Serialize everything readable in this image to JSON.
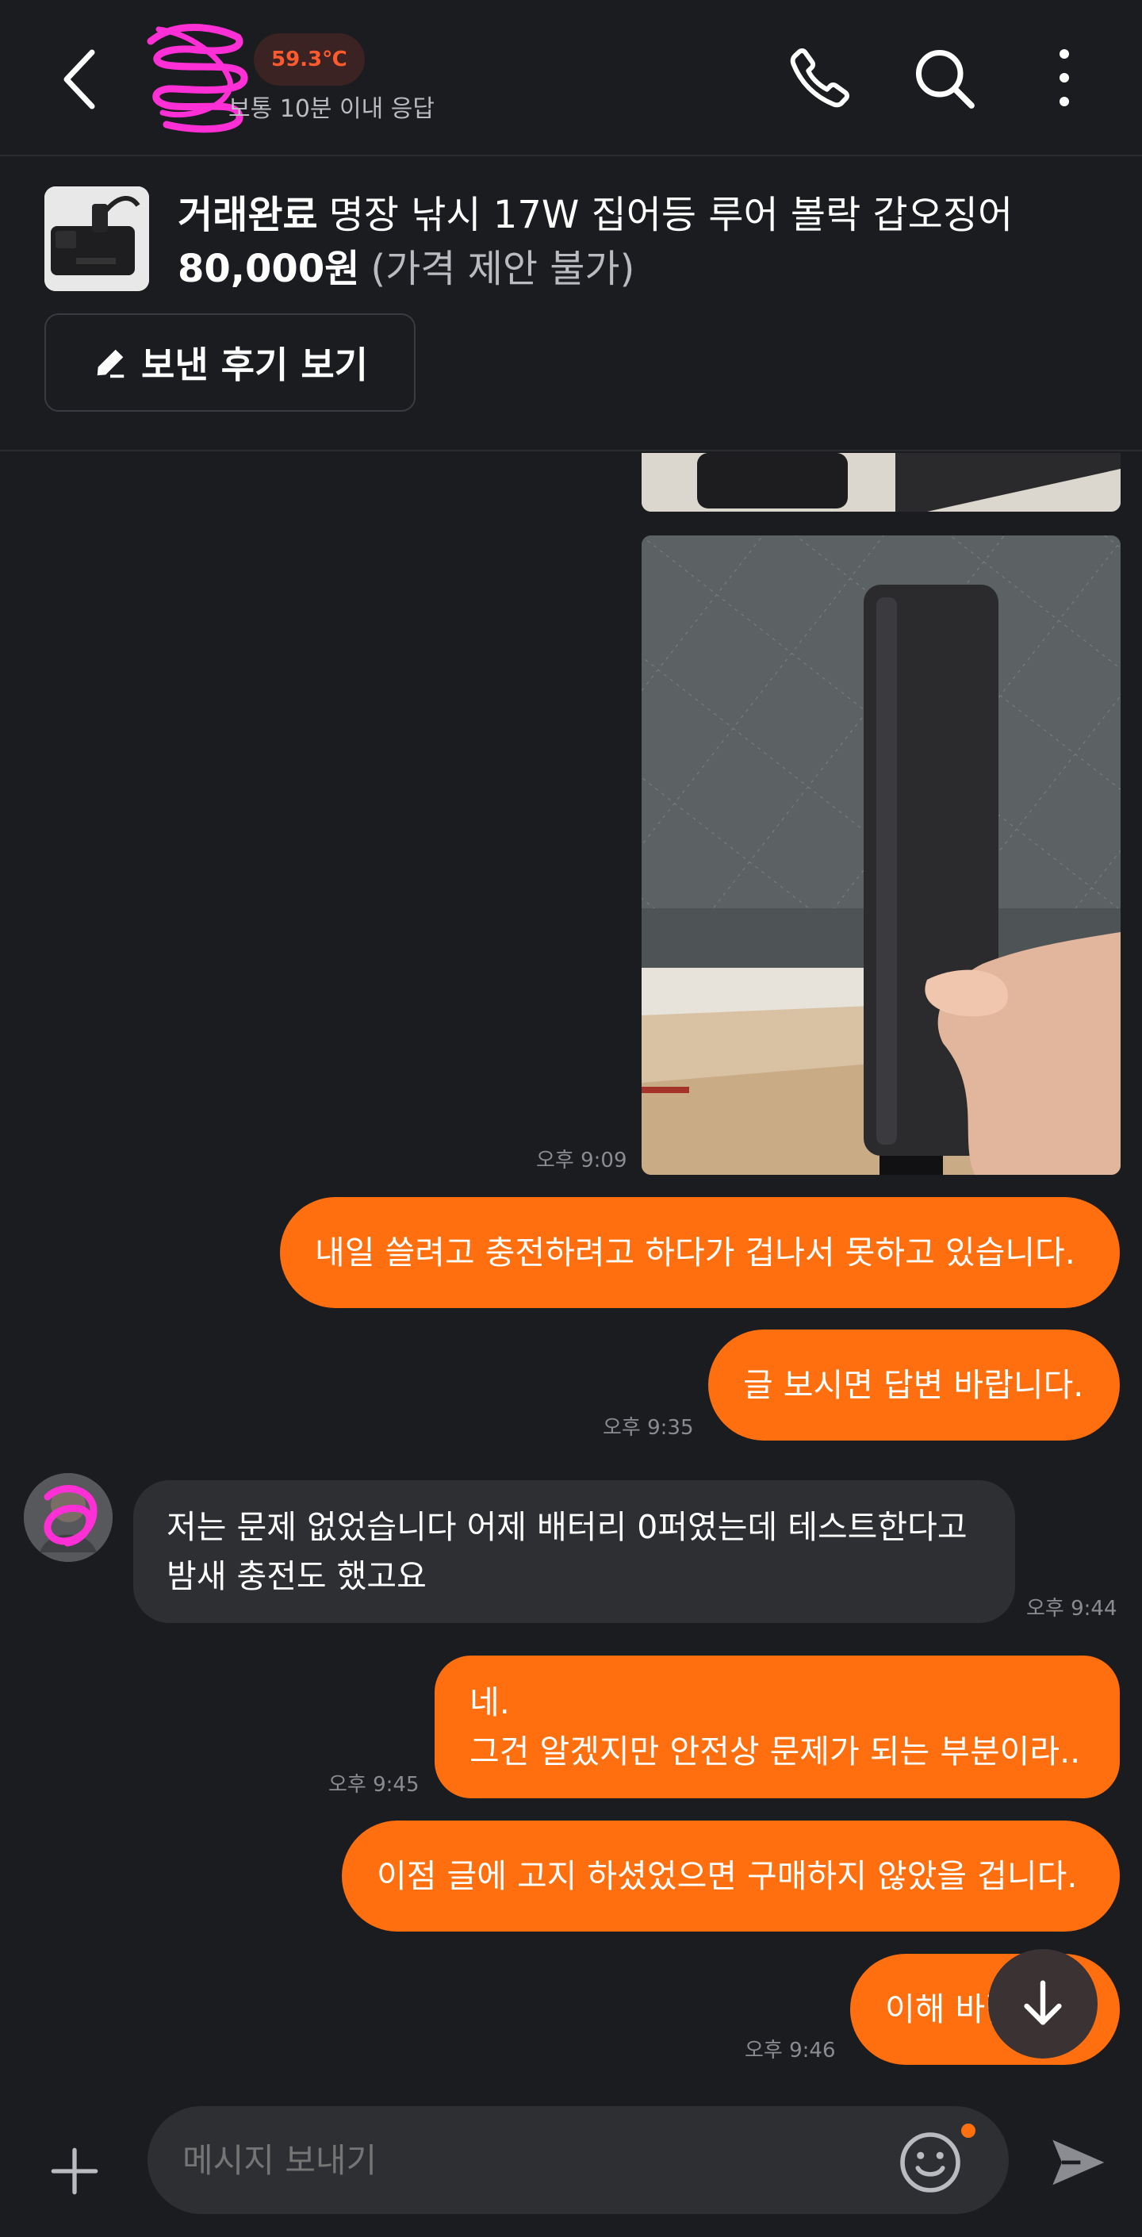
{
  "header": {
    "temperature": "59.3℃",
    "response_time": "보통 10분 이내 응답",
    "colors": {
      "accent": "#ff6f0f",
      "temp": "#ff5a2d",
      "background": "#1b1c1f"
    }
  },
  "product": {
    "status": "거래완료",
    "title": "명장 낚시 17W 집어등 루어 볼락 갑오징어",
    "price": "80,000원",
    "negotiation": "(가격 제안 불가)",
    "review_button": "보낸 후기 보기"
  },
  "messages": {
    "photo_time": "오후 9:09",
    "m1_text": "내일 쓸려고 충전하려고 하다가 겁나서 못하고 있습니다.",
    "m2_text": "글 보시면 답변 바랍니다.",
    "m2_time": "오후 9:35",
    "m3_line1": "저는 문제 없었습니다 어제 배터리 0퍼였는데 테스트한다고",
    "m3_line2": "밤새 충전도 했고요",
    "m3_time": "오후 9:44",
    "m4_line1": "네.",
    "m4_line2": "그건 알겠지만 안전상 문제가 되는 부분이라..",
    "m4_time": "오후 9:45",
    "m5_text": "이점 글에 고지 하셨었으면 구매하지 않았을 겁니다.",
    "m6_text": "이해 바랍니다.",
    "m6_time": "오후 9:46"
  },
  "input": {
    "placeholder": "메시지 보내기"
  },
  "icons": [
    "back-arrow-icon",
    "phone-icon",
    "search-icon",
    "more-vertical-icon",
    "pencil-icon",
    "arrow-down-icon",
    "plus-icon",
    "emoji-icon",
    "send-icon"
  ]
}
